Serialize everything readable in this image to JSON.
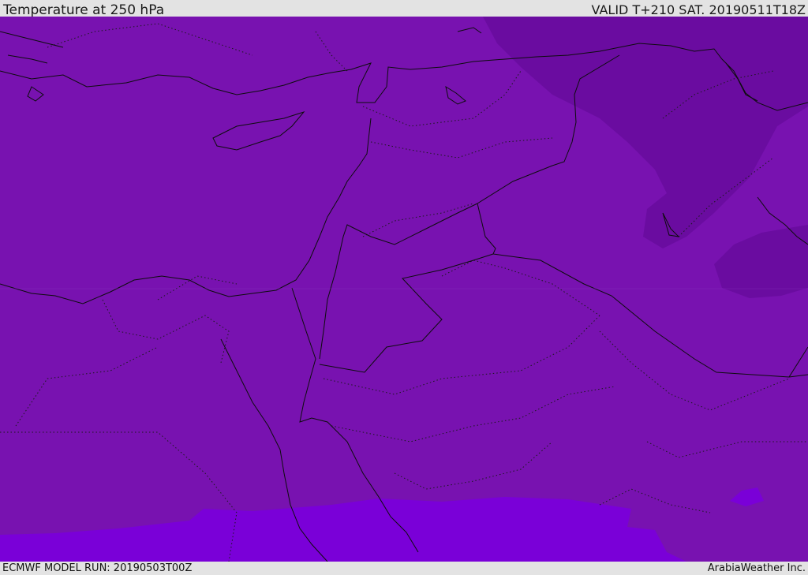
{
  "header": {
    "title": "Temperature at 250 hPa",
    "valid_time": "VALID T+210 SAT. 20190511T18Z"
  },
  "footer": {
    "model_run": "ECMWF MODEL RUN: 20190503T00Z",
    "credit": "ArabiaWeather Inc."
  },
  "map": {
    "field": "temperature",
    "level": "250 hPa",
    "colors": {
      "base_fill": "#7812b0",
      "cold_fill": "#6a0ca0",
      "warm_fill": "#7a00d8",
      "border_line": "#0d0d0d"
    }
  }
}
